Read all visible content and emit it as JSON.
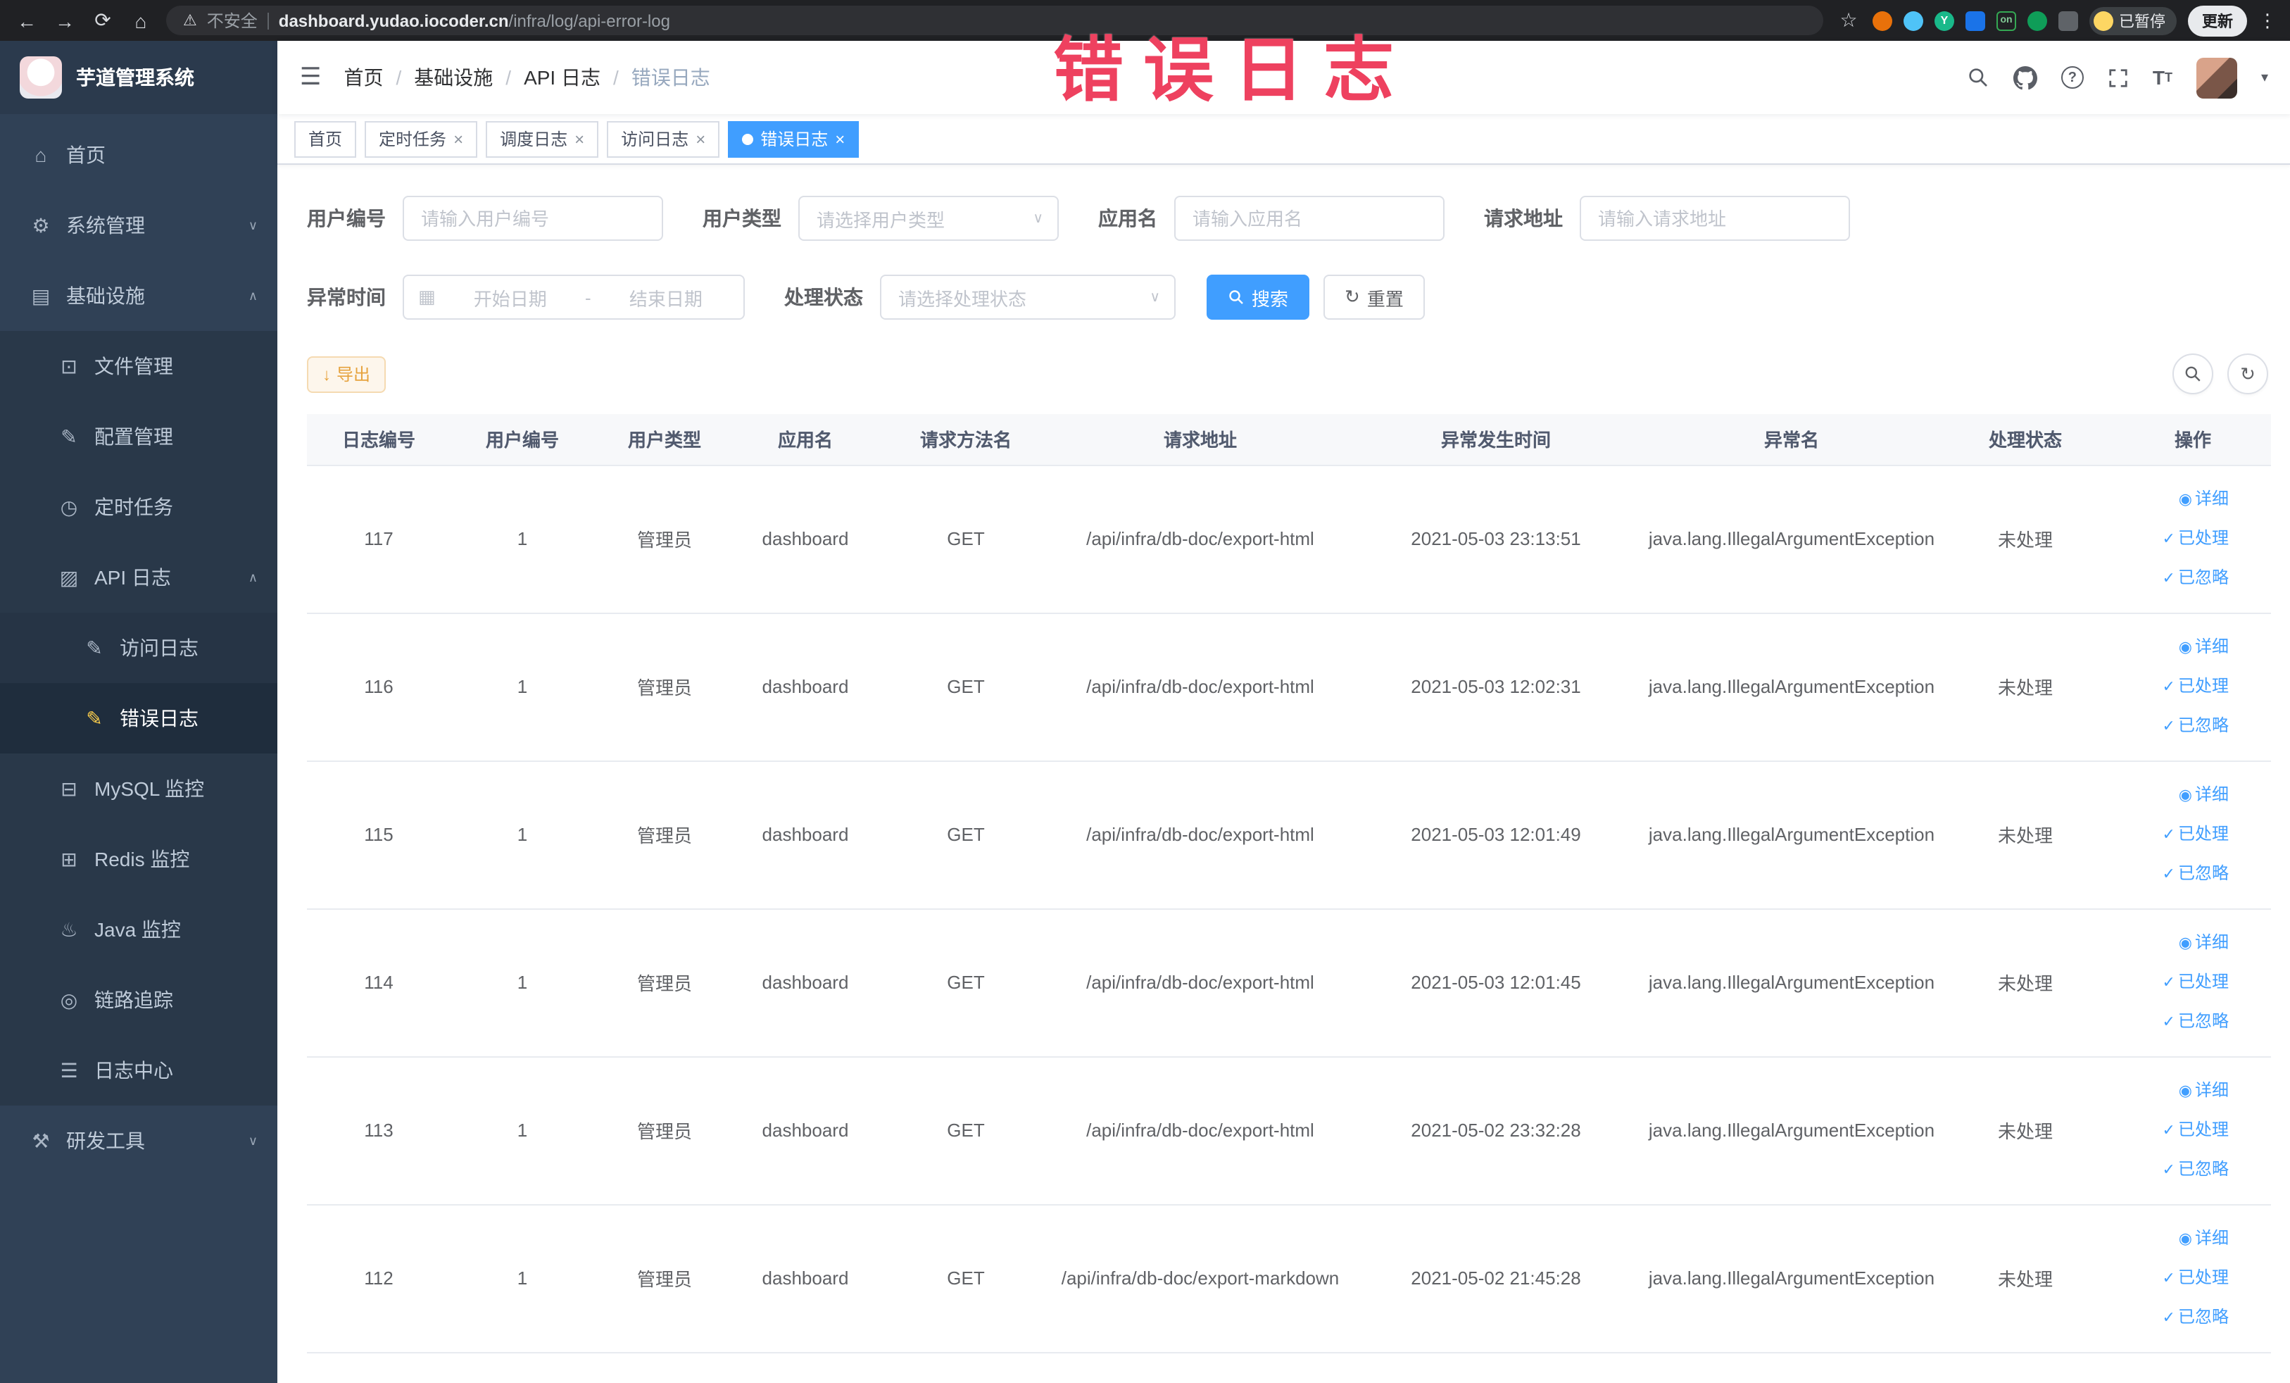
{
  "browser": {
    "security_label": "不安全",
    "url_host": "dashboard.yudao.iocoder.cn",
    "url_path": "/infra/log/api-error-log",
    "paused_badge": "已暂停",
    "update_label": "更新",
    "extension_on_badge": "on",
    "extension_y_badge": "Y"
  },
  "icons": {
    "back": "←",
    "forward": "→",
    "reload": "⟳",
    "home": "⌂",
    "warning": "⚠",
    "star": "☆",
    "kebab": "⋮",
    "menu": "☰",
    "sep": "/",
    "caret_down": "▾",
    "check": "✓",
    "eye": "◉",
    "refresh": "↻",
    "download": "↓",
    "calendar": "▦",
    "close": "×",
    "chevron_down": "∨",
    "chevron_up": "∧",
    "question": "?",
    "font_size_big": "T",
    "font_size_small": "T"
  },
  "sidebar": {
    "title": "芋道管理系统",
    "items": [
      {
        "label": "首页",
        "icon": "⌂"
      },
      {
        "label": "系统管理",
        "icon": "⚙"
      },
      {
        "label": "基础设施",
        "icon": "▤"
      },
      {
        "label": "文件管理",
        "icon": "⊡"
      },
      {
        "label": "配置管理",
        "icon": "✎"
      },
      {
        "label": "定时任务",
        "icon": "◷"
      },
      {
        "label": "API 日志",
        "icon": "▨"
      },
      {
        "label": "访问日志",
        "icon": "✎"
      },
      {
        "label": "错误日志",
        "icon": "✎"
      },
      {
        "label": "MySQL 监控",
        "icon": "⊟"
      },
      {
        "label": "Redis 监控",
        "icon": "⊞"
      },
      {
        "label": "Java 监控",
        "icon": "♨"
      },
      {
        "label": "链路追踪",
        "icon": "◎"
      },
      {
        "label": "日志中心",
        "icon": "☰"
      },
      {
        "label": "研发工具",
        "icon": "⚒"
      }
    ]
  },
  "header": {
    "breadcrumb": [
      "首页",
      "基础设施",
      "API 日志",
      "错误日志"
    ]
  },
  "tabs": [
    {
      "label": "首页"
    },
    {
      "label": "定时任务"
    },
    {
      "label": "调度日志"
    },
    {
      "label": "访问日志"
    },
    {
      "label": "错误日志"
    }
  ],
  "filters": {
    "user_id": {
      "label": "用户编号",
      "placeholder": "请输入用户编号"
    },
    "user_type": {
      "label": "用户类型",
      "placeholder": "请选择用户类型"
    },
    "app_name": {
      "label": "应用名",
      "placeholder": "请输入应用名"
    },
    "request_url": {
      "label": "请求地址",
      "placeholder": "请输入请求地址"
    },
    "exception_time": {
      "label": "异常时间",
      "start_placeholder": "开始日期",
      "separator": "-",
      "end_placeholder": "结束日期"
    },
    "process_status": {
      "label": "处理状态",
      "placeholder": "请选择处理状态"
    },
    "search_label": "搜索",
    "reset_label": "重置"
  },
  "toolbar": {
    "export_label": "导出"
  },
  "table": {
    "headers": [
      "日志编号",
      "用户编号",
      "用户类型",
      "应用名",
      "请求方法名",
      "请求地址",
      "异常发生时间",
      "异常名",
      "处理状态",
      "操作"
    ],
    "row_actions": {
      "detail": "详细",
      "processed": "已处理",
      "ignored": "已忽略"
    },
    "rows": [
      {
        "id": "117",
        "user_id": "1",
        "user_type": "管理员",
        "app": "dashboard",
        "method": "GET",
        "url": "/api/infra/db-doc/export-html",
        "time": "2021-05-03 23:13:51",
        "exception": "java.lang.IllegalArgumentException",
        "status": "未处理"
      },
      {
        "id": "116",
        "user_id": "1",
        "user_type": "管理员",
        "app": "dashboard",
        "method": "GET",
        "url": "/api/infra/db-doc/export-html",
        "time": "2021-05-03 12:02:31",
        "exception": "java.lang.IllegalArgumentException",
        "status": "未处理"
      },
      {
        "id": "115",
        "user_id": "1",
        "user_type": "管理员",
        "app": "dashboard",
        "method": "GET",
        "url": "/api/infra/db-doc/export-html",
        "time": "2021-05-03 12:01:49",
        "exception": "java.lang.IllegalArgumentException",
        "status": "未处理"
      },
      {
        "id": "114",
        "user_id": "1",
        "user_type": "管理员",
        "app": "dashboard",
        "method": "GET",
        "url": "/api/infra/db-doc/export-html",
        "time": "2021-05-03 12:01:45",
        "exception": "java.lang.IllegalArgumentException",
        "status": "未处理"
      },
      {
        "id": "113",
        "user_id": "1",
        "user_type": "管理员",
        "app": "dashboard",
        "method": "GET",
        "url": "/api/infra/db-doc/export-html",
        "time": "2021-05-02 23:32:28",
        "exception": "java.lang.IllegalArgumentException",
        "status": "未处理"
      },
      {
        "id": "112",
        "user_id": "1",
        "user_type": "管理员",
        "app": "dashboard",
        "method": "GET",
        "url": "/api/infra/db-doc/export-markdown",
        "time": "2021-05-02 21:45:28",
        "exception": "java.lang.IllegalArgumentException",
        "status": "未处理"
      }
    ]
  },
  "annotation": {
    "text": "错误日志"
  },
  "colors": {
    "accent": "#409eff",
    "warning": "#e6a23c",
    "sidebar_bg": "#304156",
    "annotation": "#ee415f"
  }
}
